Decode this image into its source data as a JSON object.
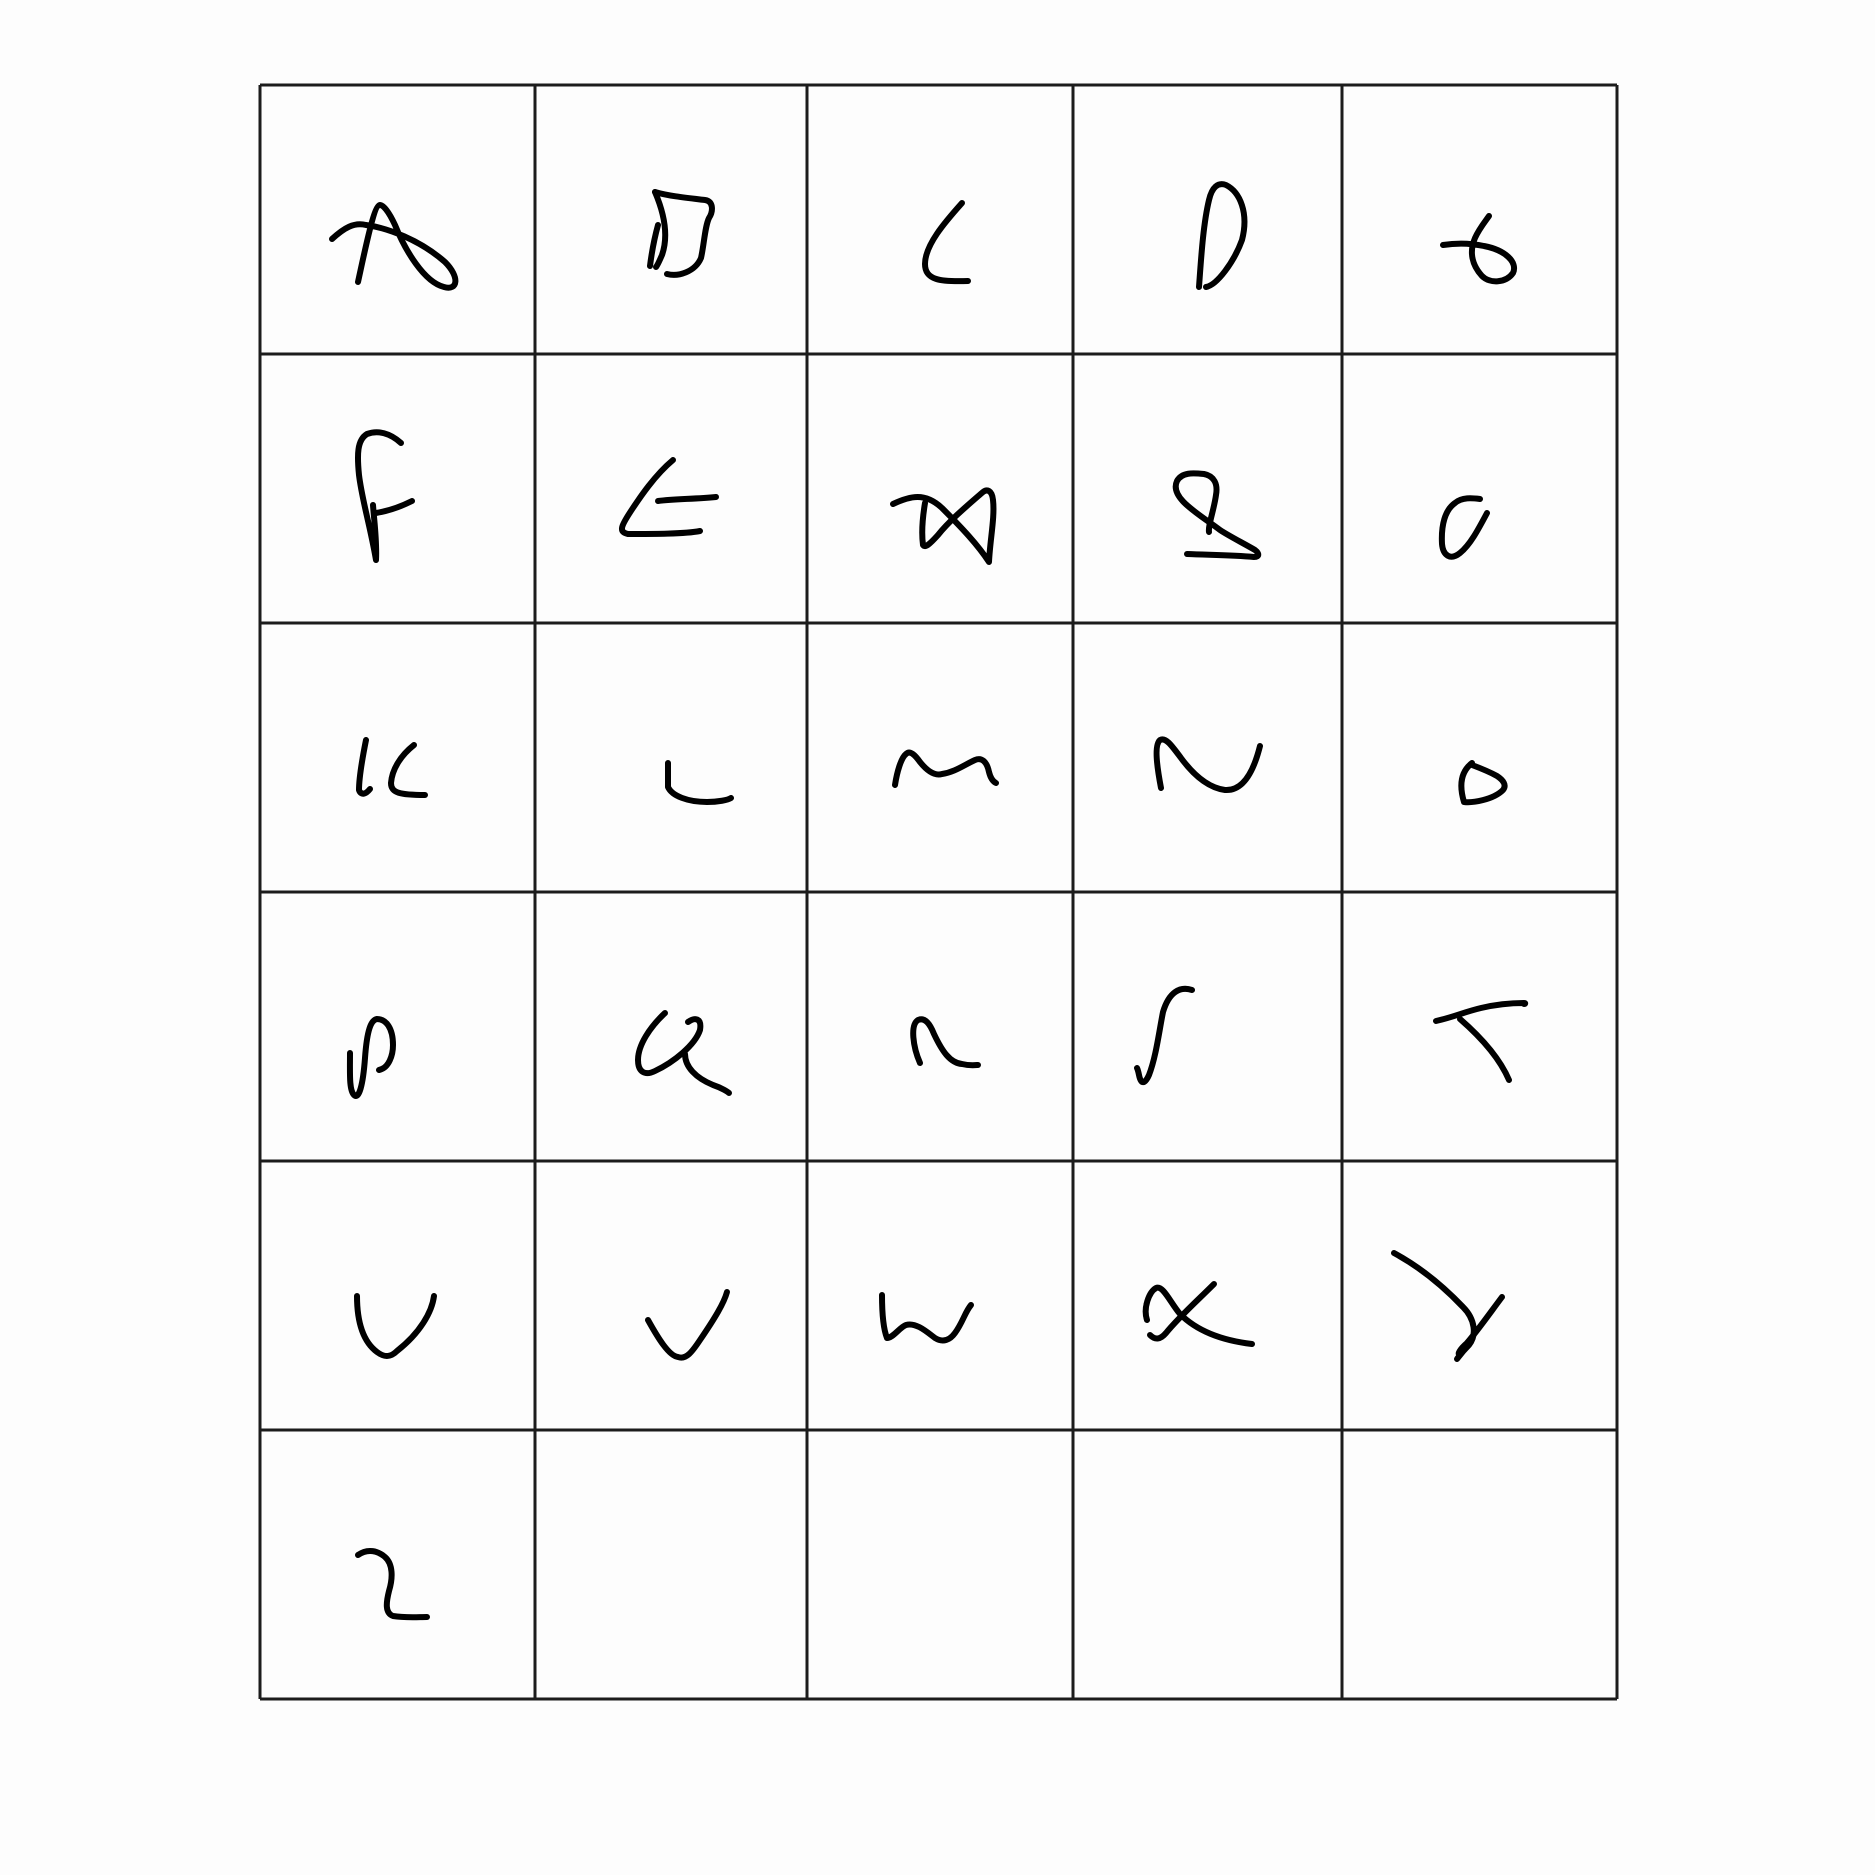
{
  "sheet": {
    "rows": 6,
    "columns": 5,
    "background_color": "#fdfdfd",
    "line_color": "#1c1c1c",
    "ink_color": "#000000"
  },
  "cells": [
    {
      "glyph": "handwritten-a",
      "filled": true
    },
    {
      "glyph": "handwritten-b",
      "filled": true
    },
    {
      "glyph": "handwritten-c",
      "filled": true
    },
    {
      "glyph": "handwritten-d",
      "filled": true
    },
    {
      "glyph": "handwritten-e",
      "filled": true
    },
    {
      "glyph": "handwritten-f",
      "filled": true
    },
    {
      "glyph": "handwritten-g",
      "filled": true
    },
    {
      "glyph": "handwritten-h",
      "filled": true
    },
    {
      "glyph": "handwritten-i",
      "filled": true
    },
    {
      "glyph": "handwritten-j",
      "filled": true
    },
    {
      "glyph": "handwritten-k",
      "filled": true
    },
    {
      "glyph": "handwritten-l",
      "filled": true
    },
    {
      "glyph": "handwritten-m",
      "filled": true
    },
    {
      "glyph": "handwritten-n",
      "filled": true
    },
    {
      "glyph": "handwritten-o",
      "filled": true
    },
    {
      "glyph": "handwritten-p",
      "filled": true
    },
    {
      "glyph": "handwritten-q",
      "filled": true
    },
    {
      "glyph": "handwritten-r",
      "filled": true
    },
    {
      "glyph": "handwritten-s",
      "filled": true
    },
    {
      "glyph": "handwritten-t",
      "filled": true
    },
    {
      "glyph": "handwritten-u",
      "filled": true
    },
    {
      "glyph": "handwritten-v",
      "filled": true
    },
    {
      "glyph": "handwritten-w",
      "filled": true
    },
    {
      "glyph": "handwritten-x",
      "filled": true
    },
    {
      "glyph": "handwritten-y",
      "filled": true
    },
    {
      "glyph": "handwritten-z",
      "filled": true
    },
    {
      "glyph": "",
      "filled": false
    },
    {
      "glyph": "",
      "filled": false
    },
    {
      "glyph": "",
      "filled": false
    },
    {
      "glyph": "",
      "filled": false
    }
  ]
}
